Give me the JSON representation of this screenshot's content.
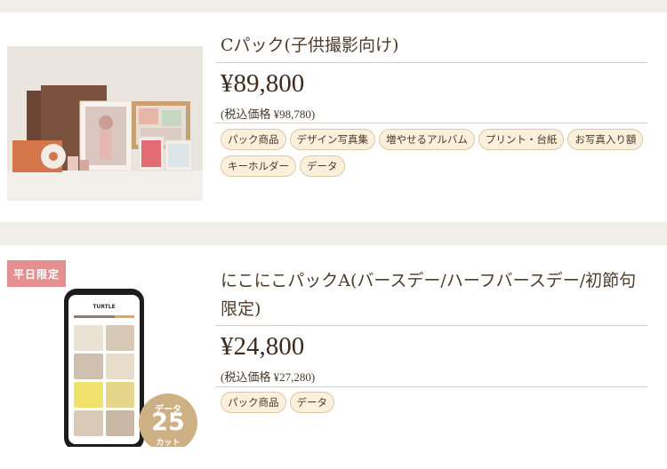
{
  "packages": [
    {
      "title": "Cパック(子供撮影向け)",
      "price": "¥89,800",
      "tax_note": "(税込価格 ¥98,780)",
      "tags": [
        "パック商品",
        "デザイン写真集",
        "増やせるアルバム",
        "プリント・台紙",
        "お写真入り額",
        "キーホルダー",
        "データ"
      ]
    },
    {
      "badge": "平日限定",
      "title": "にこにこパックA(バースデー/ハーフバースデー/初節句限定)",
      "price": "¥24,800",
      "tax_note": "(税込価格 ¥27,280)",
      "tags": [
        "パック商品",
        "データ"
      ],
      "data_badge": {
        "line1": "データ",
        "count": "25",
        "line3": "カット"
      },
      "phone_logo": "TURTLE"
    }
  ],
  "colors": {
    "page_bg": "#f1ede7",
    "tag_bg": "#fbf0db",
    "tag_border": "#dcc8a6",
    "weekday_badge": "#e58f91",
    "data_badge": "#cdb184"
  }
}
